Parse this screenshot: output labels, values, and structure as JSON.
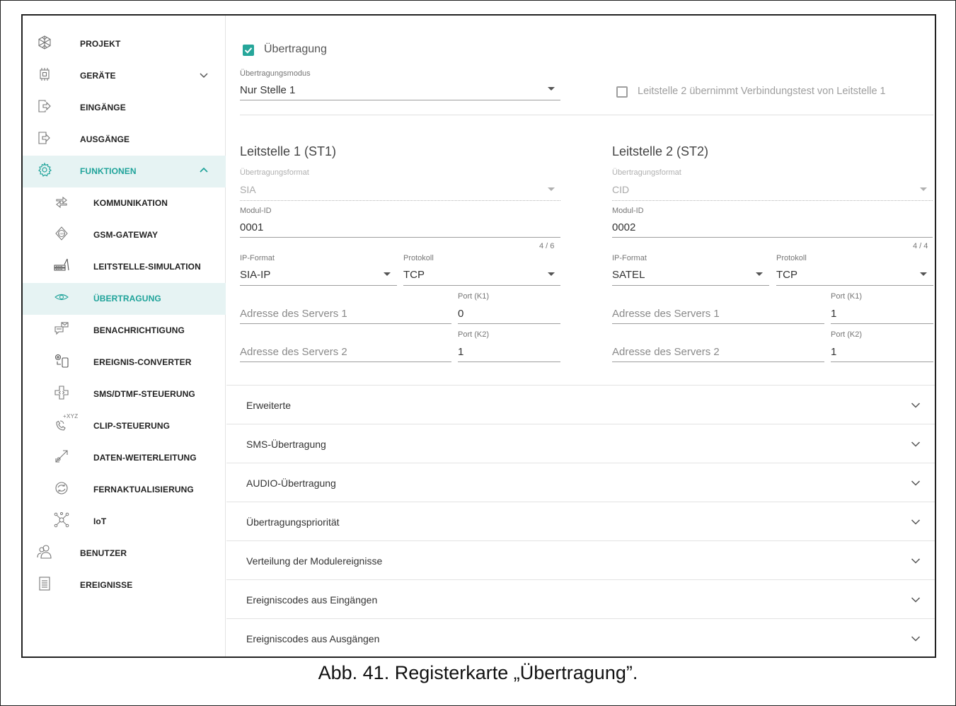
{
  "sidebar": {
    "items": [
      {
        "label": "PROJEKT",
        "icon": "snowflake-project-icon"
      },
      {
        "label": "GERÄTE",
        "icon": "chip-devices-icon",
        "chevron": "down"
      },
      {
        "label": "EINGÄNGE",
        "icon": "input-arrow-icon"
      },
      {
        "label": "AUSGÄNGE",
        "icon": "output-arrow-icon"
      },
      {
        "label": "FUNKTIONEN",
        "icon": "gear-icon",
        "chevron": "up"
      },
      {
        "label": "KOMMUNIKATION",
        "icon": "exchange-arrows-icon"
      },
      {
        "label": "GSM-GATEWAY",
        "icon": "gsm-gateway-icon"
      },
      {
        "label": "LEITSTELLE-SIMULATION",
        "icon": "station-simulation-icon"
      },
      {
        "label": "ÜBERTRAGUNG",
        "icon": "eye-icon"
      },
      {
        "label": "BENACHRICHTIGUNG",
        "icon": "notification-chat-icon"
      },
      {
        "label": "EREIGNIS-CONVERTER",
        "icon": "event-converter-icon"
      },
      {
        "label": "SMS/DTMF-STEUERUNG",
        "icon": "sms-dtmf-icon"
      },
      {
        "label": "CLIP-STEUERUNG",
        "icon": "phone-xyz-icon",
        "icon_text": "+XYZ"
      },
      {
        "label": "DATEN-WEITERLEITUNG",
        "icon": "data-forward-icon"
      },
      {
        "label": "FERNAKTUALISIERUNG",
        "icon": "refresh-icon"
      },
      {
        "label": "IoT",
        "icon": "iot-network-icon"
      },
      {
        "label": "BENUTZER",
        "icon": "users-icon"
      },
      {
        "label": "EREIGNISSE",
        "icon": "event-list-icon"
      }
    ]
  },
  "main": {
    "transmission_checkbox_label": "Übertragung",
    "transmission_checked": true,
    "mode_label": "Übertragungsmodus",
    "mode_value": "Nur Stelle 1",
    "takeover_label": "Leitstelle 2 übernimmt Verbindungstest von Leitstelle 1",
    "takeover_checked": false,
    "st1": {
      "title": "Leitstelle 1 (ST1)",
      "format_label": "Übertragungsformat",
      "format_value": "SIA",
      "module_id_label": "Modul-ID",
      "module_id_value": "0001",
      "counter": "4 / 6",
      "ip_format_label": "IP-Format",
      "ip_format_value": "SIA-IP",
      "protocol_label": "Protokoll",
      "protocol_value": "TCP",
      "server1_placeholder": "Adresse des Servers 1",
      "port1_label": "Port (K1)",
      "port1_value": "0",
      "server2_placeholder": "Adresse des Servers 2",
      "port2_label": "Port (K2)",
      "port2_value": "1"
    },
    "st2": {
      "title": "Leitstelle 2 (ST2)",
      "format_label": "Übertragungsformat",
      "format_value": "CID",
      "module_id_label": "Modul-ID",
      "module_id_value": "0002",
      "counter": "4 / 4",
      "ip_format_label": "IP-Format",
      "ip_format_value": "SATEL",
      "protocol_label": "Protokoll",
      "protocol_value": "TCP",
      "server1_placeholder": "Adresse des Servers 1",
      "port1_label": "Port (K1)",
      "port1_value": "1",
      "server2_placeholder": "Adresse des Servers 2",
      "port2_label": "Port (K2)",
      "port2_value": "1"
    },
    "accordions": [
      "Erweiterte",
      "SMS-Übertragung",
      "AUDIO-Übertragung",
      "Übertragungspriorität",
      "Verteilung der Modulereignisse",
      "Ereigniscodes aus Eingängen",
      "Ereigniscodes aus Ausgängen"
    ]
  },
  "caption": "Abb. 41. Registerkarte „Übertragung”.",
  "colors": {
    "accent": "#26a69a",
    "active_bg": "#e6f3f3",
    "active_text": "#1fa39a"
  }
}
